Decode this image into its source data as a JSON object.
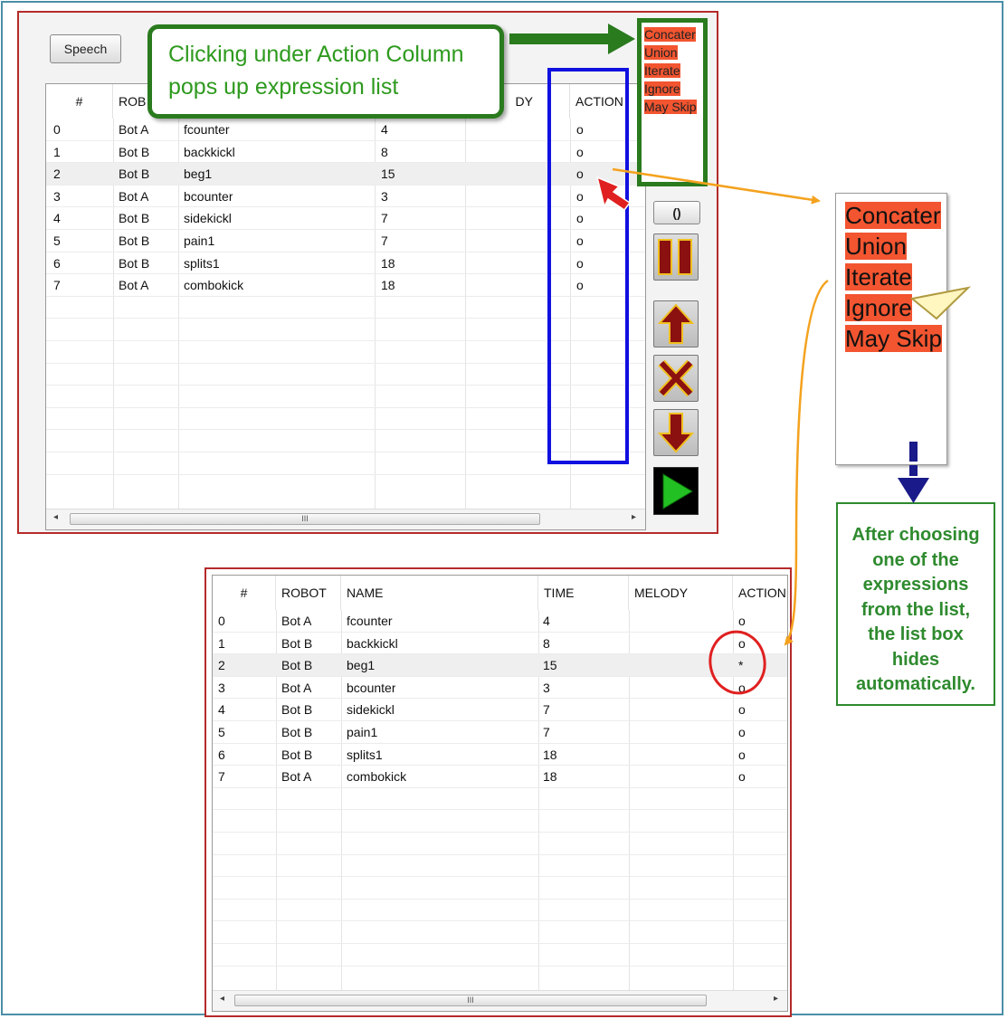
{
  "top_panel": {
    "speech_button": "Speech",
    "columns": [
      "#",
      "ROBOT",
      "NAME",
      "TIME",
      "MELODY",
      "ACTION"
    ],
    "column_visible_text": [
      "#",
      "ROB",
      "",
      "",
      "DY",
      "ACTION"
    ],
    "rows": [
      {
        "num": "0",
        "robot": "Bot A",
        "name": "fcounter",
        "time": "4",
        "melody": "",
        "action": "o"
      },
      {
        "num": "1",
        "robot": "Bot B",
        "name": "backkickl",
        "time": "8",
        "melody": "",
        "action": "o"
      },
      {
        "num": "2",
        "robot": "Bot B",
        "name": "beg1",
        "time": "15",
        "melody": "",
        "action": "o"
      },
      {
        "num": "3",
        "robot": "Bot A",
        "name": "bcounter",
        "time": "3",
        "melody": "",
        "action": "o"
      },
      {
        "num": "4",
        "robot": "Bot B",
        "name": "sidekickl",
        "time": "7",
        "melody": "",
        "action": "o"
      },
      {
        "num": "5",
        "robot": "Bot B",
        "name": "pain1",
        "time": "7",
        "melody": "",
        "action": "o"
      },
      {
        "num": "6",
        "robot": "Bot B",
        "name": "splits1",
        "time": "18",
        "melody": "",
        "action": "o"
      },
      {
        "num": "7",
        "robot": "Bot A",
        "name": "combokick",
        "time": "18",
        "melody": "",
        "action": "o"
      }
    ],
    "selected_row": 2,
    "scroll_thumb_glyph": "III",
    "paren_button": "()"
  },
  "callout_lines": [
    "Clicking under Action Column",
    "pops up expression list"
  ],
  "expression_list": [
    "Concater",
    "Union",
    "Iterate",
    "Ignore",
    "May Skip"
  ],
  "bottom_panel": {
    "columns": [
      "#",
      "ROBOT",
      "NAME",
      "TIME",
      "MELODY",
      "ACTION"
    ],
    "column_visible_text": [
      "#",
      "ROBOT",
      "NAME",
      "TIME",
      "MELODY",
      "ACTION"
    ],
    "rows": [
      {
        "num": "0",
        "robot": "Bot A",
        "name": "fcounter",
        "time": "4",
        "melody": "",
        "action": "o"
      },
      {
        "num": "1",
        "robot": "Bot B",
        "name": "backkickl",
        "time": "8",
        "melody": "",
        "action": "o"
      },
      {
        "num": "2",
        "robot": "Bot B",
        "name": "beg1",
        "time": "15",
        "melody": "",
        "action": "*"
      },
      {
        "num": "3",
        "robot": "Bot A",
        "name": "bcounter",
        "time": "3",
        "melody": "",
        "action": "o"
      },
      {
        "num": "4",
        "robot": "Bot B",
        "name": "sidekickl",
        "time": "7",
        "melody": "",
        "action": "o"
      },
      {
        "num": "5",
        "robot": "Bot B",
        "name": "pain1",
        "time": "7",
        "melody": "",
        "action": "o"
      },
      {
        "num": "6",
        "robot": "Bot B",
        "name": "splits1",
        "time": "18",
        "melody": "",
        "action": "o"
      },
      {
        "num": "7",
        "robot": "Bot A",
        "name": "combokick",
        "time": "18",
        "melody": "",
        "action": "o"
      }
    ],
    "selected_row": 2,
    "scroll_thumb_glyph": "III"
  },
  "note_lines": [
    "After choosing",
    "one of the",
    "expressions",
    "from the list,",
    "the list box",
    "hides",
    "automatically."
  ],
  "colors": {
    "panel_border": "#b52a2a",
    "callout_green": "#2a7a1e",
    "list_highlight": "#f25530",
    "highlight_blue": "#1010e0",
    "arrow_orange": "#f4a21e",
    "arrow_red": "#e02020",
    "arrow_navy": "#1a1a8a",
    "button_red": "#8b1010",
    "button_gold": "#f0c020",
    "play_green": "#22c022"
  },
  "icons": {
    "pause": "pause-icon",
    "up": "arrow-up-icon",
    "delete": "x-icon",
    "down": "arrow-down-icon",
    "play": "play-icon"
  }
}
